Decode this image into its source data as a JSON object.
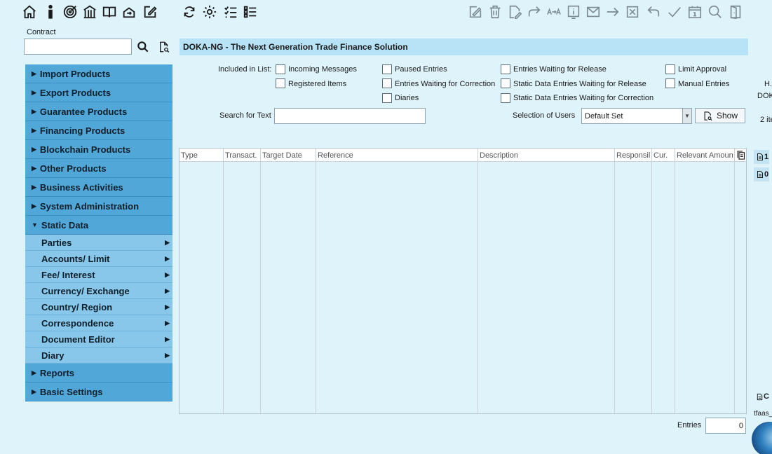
{
  "colors": {
    "background": "#dff3fb",
    "nav_main": "#52a7d9",
    "nav_sub": "#89c7ea",
    "title_bar": "#b8e2f6"
  },
  "toolbar_left_icons": [
    "home-icon",
    "info-icon",
    "target-icon",
    "building-icon",
    "book-icon",
    "transfer-icon",
    "edit-icon",
    "refresh-icon",
    "settings-icon",
    "checklist-icon",
    "list-icon"
  ],
  "toolbar_right_icons": [
    "signature-icon",
    "trash-icon",
    "document-edit-icon",
    "forward-icon",
    "swap-icon",
    "info-box-icon",
    "mail-icon",
    "arrow-right-icon",
    "close-box-icon",
    "undo-icon",
    "check-icon",
    "calendar-icon",
    "magnifier-icon",
    "exit-icon"
  ],
  "contract": {
    "label": "Contract",
    "value": ""
  },
  "sidebar": {
    "main_top": [
      "Import Products",
      "Export Products",
      "Guarantee Products",
      "Financing Products",
      "Blockchain Products",
      "Other Products",
      "Business Activities",
      "System Administration"
    ],
    "expanded": "Static Data",
    "sub_items": [
      "Parties",
      "Accounts/ Limit",
      "Fee/ Interest",
      "Currency/ Exchange",
      "Country/ Region",
      "Correspondence",
      "Document Editor",
      "Diary"
    ],
    "main_bottom": [
      "Reports",
      "Basic Settings"
    ]
  },
  "header": {
    "title": "DOKA-NG - The Next Generation Trade Finance Solution"
  },
  "filters": {
    "included_label": "Included in List:",
    "checkboxes": {
      "incoming_messages": "Incoming Messages",
      "registered_items": "Registered Items",
      "paused_entries": "Paused Entries",
      "entries_waiting_correction": "Entries Waiting for Correction",
      "diaries": "Diaries",
      "entries_waiting_release": "Entries Waiting for Release",
      "static_waiting_release": "Static Data Entries Waiting for Release",
      "static_waiting_correction": "Static Data Entries Waiting for Correction",
      "limit_approval": "Limit Approval",
      "manual_entries": "Manual Entries"
    },
    "search_label": "Search for Text",
    "search_value": "",
    "users_label": "Selection of Users",
    "users_value": "Default Set",
    "show_button": "Show"
  },
  "table": {
    "columns": [
      "Type",
      "Transact.",
      "Target Date",
      "Reference",
      "Description",
      "Responsil",
      "Cur.",
      "Relevant Amoun"
    ]
  },
  "footer": {
    "entries_label": "Entries",
    "entries_value": "0"
  },
  "right_panel": {
    "line1": "H.",
    "line2": "DOK",
    "line3": "2 ite",
    "doc1": "1",
    "doc2": "0",
    "doc3": "C",
    "user": "tfaas_"
  }
}
